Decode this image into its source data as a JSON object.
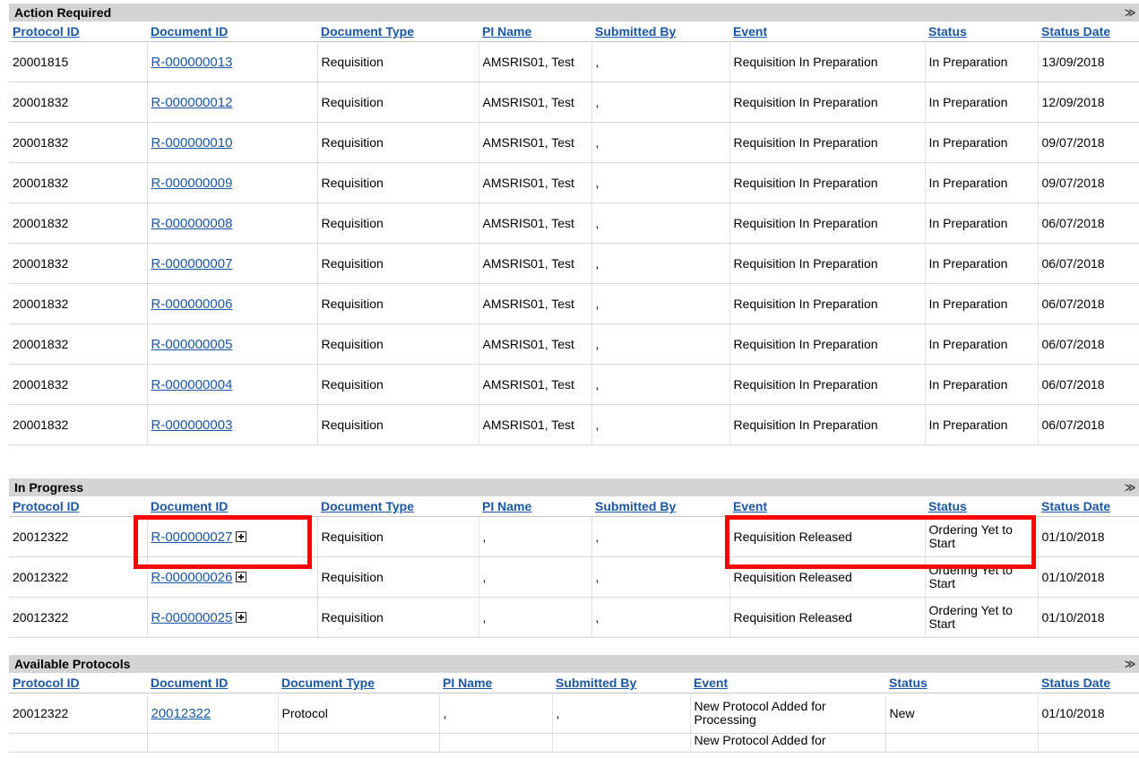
{
  "action_required": {
    "title": "Action Required",
    "collapse_glyph": "≫",
    "columns": [
      "Protocol ID",
      "Document ID",
      "Document Type",
      "PI Name",
      "Submitted By",
      "Event",
      "Status",
      "Status Date"
    ],
    "rows": [
      [
        "20001815",
        "R-000000013",
        "Requisition",
        "AMSRIS01, Test",
        ",",
        "Requisition In Preparation",
        "In Preparation",
        "13/09/2018"
      ],
      [
        "20001832",
        "R-000000012",
        "Requisition",
        "AMSRIS01, Test",
        ",",
        "Requisition In Preparation",
        "In Preparation",
        "12/09/2018"
      ],
      [
        "20001832",
        "R-000000010",
        "Requisition",
        "AMSRIS01, Test",
        ",",
        "Requisition In Preparation",
        "In Preparation",
        "09/07/2018"
      ],
      [
        "20001832",
        "R-000000009",
        "Requisition",
        "AMSRIS01, Test",
        ",",
        "Requisition In Preparation",
        "In Preparation",
        "09/07/2018"
      ],
      [
        "20001832",
        "R-000000008",
        "Requisition",
        "AMSRIS01, Test",
        ",",
        "Requisition In Preparation",
        "In Preparation",
        "06/07/2018"
      ],
      [
        "20001832",
        "R-000000007",
        "Requisition",
        "AMSRIS01, Test",
        ",",
        "Requisition In Preparation",
        "In Preparation",
        "06/07/2018"
      ],
      [
        "20001832",
        "R-000000006",
        "Requisition",
        "AMSRIS01, Test",
        ",",
        "Requisition In Preparation",
        "In Preparation",
        "06/07/2018"
      ],
      [
        "20001832",
        "R-000000005",
        "Requisition",
        "AMSRIS01, Test",
        ",",
        "Requisition In Preparation",
        "In Preparation",
        "06/07/2018"
      ],
      [
        "20001832",
        "R-000000004",
        "Requisition",
        "AMSRIS01, Test",
        ",",
        "Requisition In Preparation",
        "In Preparation",
        "06/07/2018"
      ],
      [
        "20001832",
        "R-000000003",
        "Requisition",
        "AMSRIS01, Test",
        ",",
        "Requisition In Preparation",
        "In Preparation",
        "06/07/2018"
      ]
    ]
  },
  "in_progress": {
    "title": "In Progress",
    "collapse_glyph": "≫",
    "columns": [
      "Protocol ID",
      "Document ID",
      "Document Type",
      "PI Name",
      "Submitted By",
      "Event",
      "Status",
      "Status Date"
    ],
    "rows": [
      [
        "20012322",
        "R-000000027",
        "Requisition",
        ",",
        ",",
        "Requisition Released",
        "Ordering Yet to Start",
        "01/10/2018"
      ],
      [
        "20012322",
        "R-000000026",
        "Requisition",
        ",",
        ",",
        "Requisition Released",
        "Ordering Yet to Start",
        "01/10/2018"
      ],
      [
        "20012322",
        "R-000000025",
        "Requisition",
        ",",
        ",",
        "Requisition Released",
        "Ordering Yet to Start",
        "01/10/2018"
      ]
    ]
  },
  "available_protocols": {
    "title": "Available Protocols",
    "collapse_glyph": "≫",
    "columns": [
      "Protocol ID",
      "Document ID",
      "Document Type",
      "PI Name",
      "Submitted By",
      "Event",
      "Status",
      "Status Date"
    ],
    "rows": [
      [
        "20012322",
        "20012322",
        "Protocol",
        ",",
        ",",
        "New Protocol Added for Processing",
        "New",
        "01/10/2018"
      ],
      [
        "",
        "",
        "",
        "",
        "",
        "New Protocol Added for",
        "",
        ""
      ]
    ]
  },
  "colors": {
    "link": "#1a56a6",
    "header_bg": "#d4d4d4",
    "highlight": "#ff0000"
  }
}
